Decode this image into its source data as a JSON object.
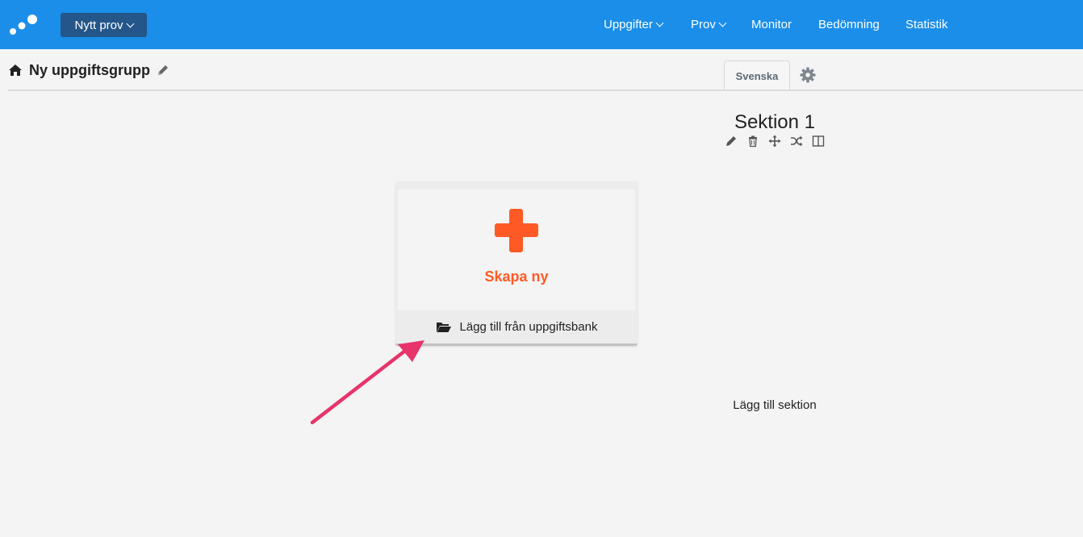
{
  "header": {
    "new_exam_label": "Nytt prov",
    "nav": [
      {
        "label": "Uppgifter",
        "dropdown": true
      },
      {
        "label": "Prov",
        "dropdown": true
      },
      {
        "label": "Monitor",
        "dropdown": false
      },
      {
        "label": "Bedömning",
        "dropdown": false
      },
      {
        "label": "Statistik",
        "dropdown": false
      }
    ]
  },
  "page": {
    "title": "Ny uppgiftsgrupp",
    "language_tab": "Svenska"
  },
  "section": {
    "title": "Sektion 1",
    "tools": [
      "pencil-icon",
      "trash-icon",
      "move-icon",
      "shuffle-icon",
      "columns-icon"
    ],
    "add_section_label": "Lägg till sektion"
  },
  "card": {
    "create_label": "Skapa ny",
    "bank_label": "Lägg till från uppgiftsbank"
  },
  "colors": {
    "topbar": "#1a8ee9",
    "new_button": "#24568a",
    "accent": "#ff5a26",
    "annotation_arrow": "#e8336b"
  }
}
